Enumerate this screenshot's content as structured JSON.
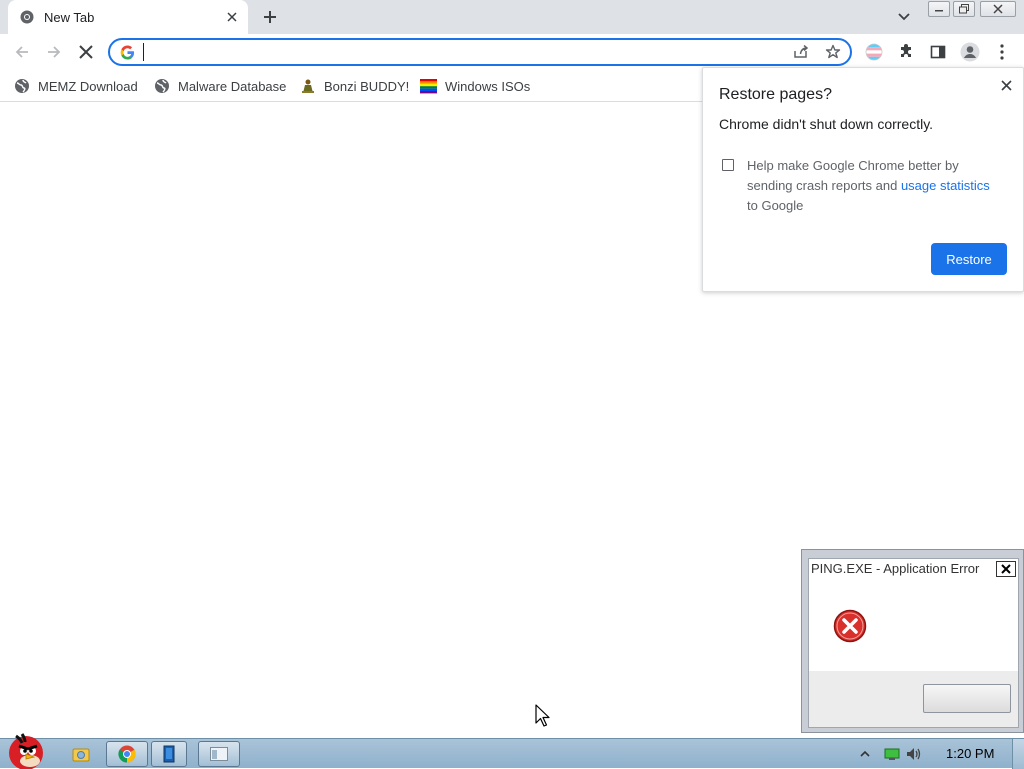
{
  "browser": {
    "tab": {
      "title": "New Tab"
    },
    "omnibox": {
      "value": ""
    },
    "bookmarks": [
      {
        "label": "MEMZ Download",
        "icon": "globe-icon"
      },
      {
        "label": "Malware Database",
        "icon": "globe-icon"
      },
      {
        "label": "Bonzi BUDDY!",
        "icon": "bonzi-icon"
      },
      {
        "label": "Windows ISOs",
        "icon": "rainbow-flag-icon"
      }
    ],
    "accent_color": "#1a73e8"
  },
  "restore_bubble": {
    "title": "Restore pages?",
    "message": "Chrome didn't shut down correctly.",
    "checkbox_text_before": "Help make Google Chrome better by sending crash reports and ",
    "checkbox_link": "usage statistics",
    "checkbox_text_after": " to Google",
    "checkbox_checked": false,
    "button_label": "Restore"
  },
  "error_dialog": {
    "title": "PING.EXE - Application Error",
    "icon": "error-icon",
    "ok_label": ""
  },
  "taskbar": {
    "clock": "1:20 PM",
    "items": [
      "explorer-icon",
      "chrome-icon",
      "app-icon",
      "window-icon"
    ]
  }
}
